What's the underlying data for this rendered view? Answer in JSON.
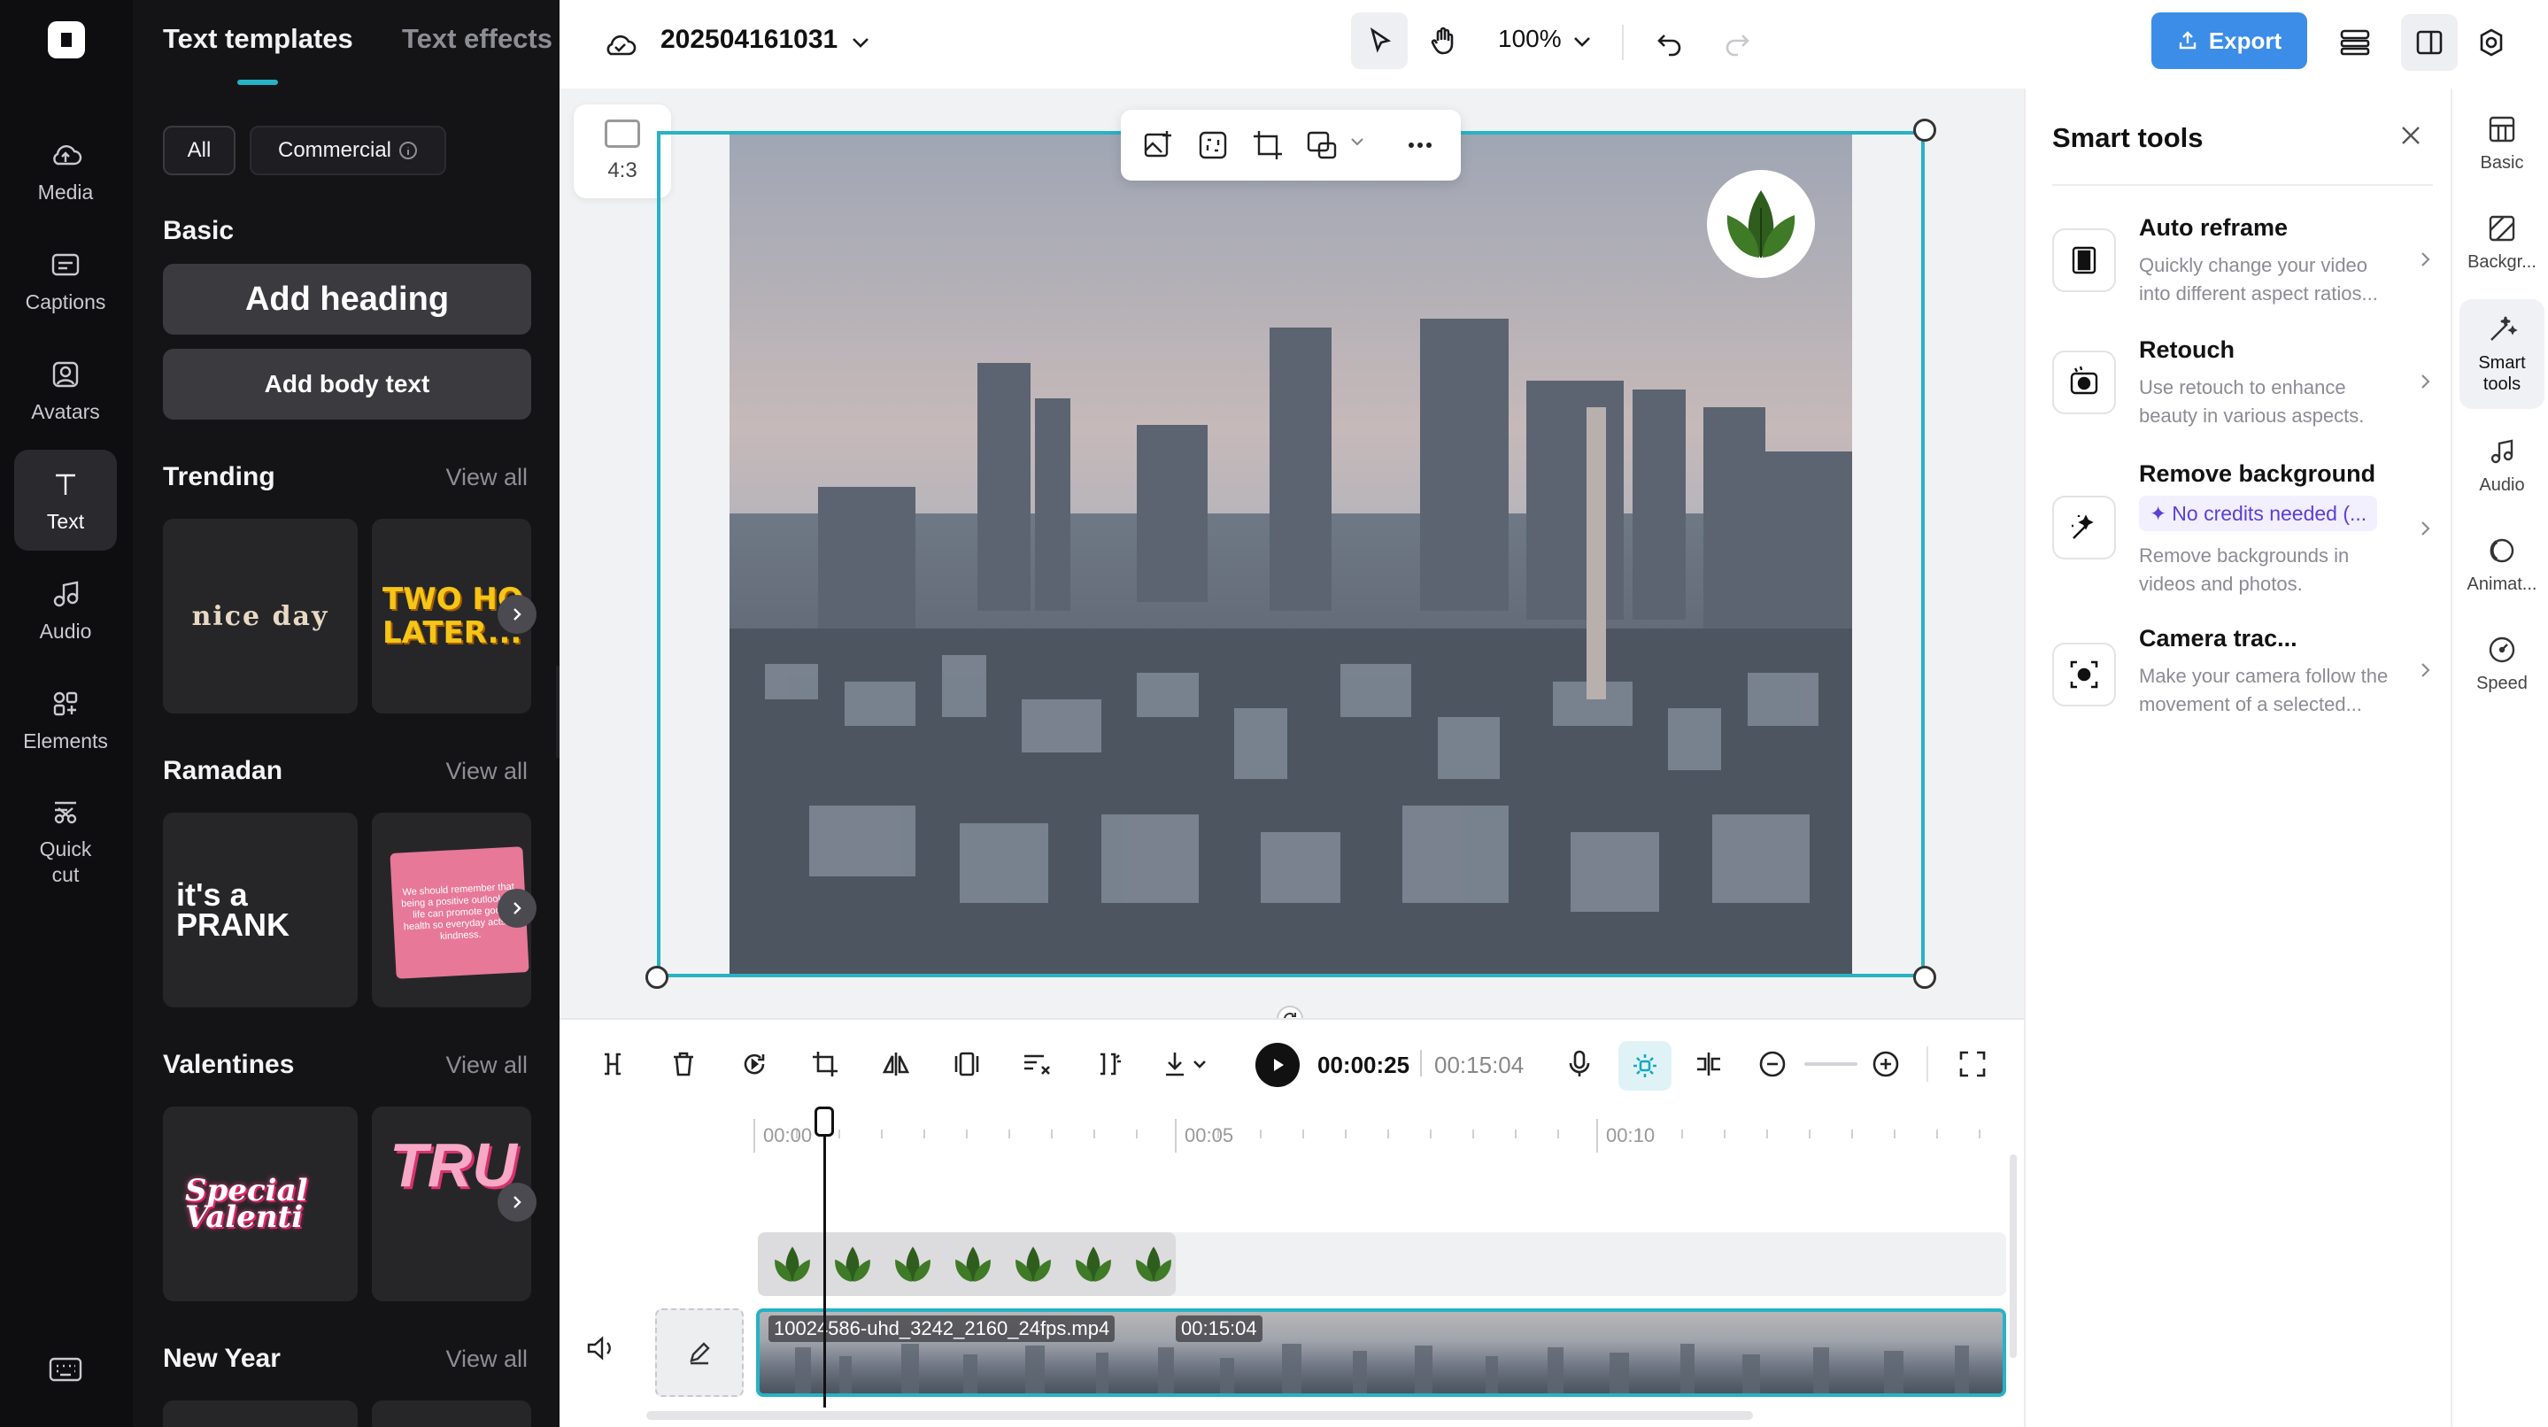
{
  "nav": {
    "items": [
      {
        "label": "Media",
        "icon": "cloud-upload-icon"
      },
      {
        "label": "Captions",
        "icon": "captions-icon"
      },
      {
        "label": "Avatars",
        "icon": "avatar-icon"
      },
      {
        "label": "Text",
        "icon": "text-icon"
      },
      {
        "label": "Audio",
        "icon": "music-note-icon"
      },
      {
        "label": "Elements",
        "icon": "elements-icon"
      },
      {
        "label": "Quick cut",
        "icon": "scissors-icon"
      }
    ],
    "active": "Text"
  },
  "panel": {
    "tabs": [
      "Text templates",
      "Text effects"
    ],
    "filters": {
      "all": "All",
      "commercial": "Commercial"
    },
    "basic": {
      "title": "Basic",
      "add_heading": "Add heading",
      "add_body": "Add body text"
    },
    "sections": [
      {
        "title": "Trending",
        "view_all": "View all",
        "tiles": [
          "nice day",
          "TWO HO LATER..."
        ]
      },
      {
        "title": "Ramadan",
        "view_all": "View all",
        "tiles": [
          "it's a PRANK",
          "We should remember that being a positive outlook on life can promote good health so everyday acts of kindness."
        ]
      },
      {
        "title": "Valentines",
        "view_all": "View all",
        "tiles": [
          "Special Valenti",
          "TRU"
        ]
      },
      {
        "title": "New Year",
        "view_all": "View all",
        "tiles": []
      }
    ]
  },
  "topbar": {
    "project_name": "202504161031",
    "zoom": "100%",
    "export_label": "Export",
    "accent": "#3b8de8"
  },
  "canvas": {
    "aspect_label": "4:3",
    "selection_color": "#27b2c6"
  },
  "timeline": {
    "current_time": "00:00:25",
    "total_time": "00:15:04",
    "ruler": [
      "00:00",
      "00:05",
      "00:10"
    ],
    "clip_name": "10024586-uhd_3242_2160_24fps.mp4",
    "clip_duration": "00:15:04"
  },
  "smart_tools": {
    "title": "Smart tools",
    "items": [
      {
        "title": "Auto reframe",
        "desc": "Quickly change your video into different aspect ratios...",
        "icon": "auto-reframe-icon"
      },
      {
        "title": "Retouch",
        "desc": "Use retouch to enhance beauty in various aspects.",
        "icon": "retouch-icon"
      },
      {
        "title": "Remove background",
        "badge": "No credits needed (...",
        "desc": "Remove backgrounds in videos and photos.",
        "icon": "magic-wand-icon"
      },
      {
        "title": "Camera trac...",
        "desc": "Make your camera follow the movement of a selected...",
        "icon": "camera-track-icon"
      }
    ]
  },
  "right_rail": {
    "items": [
      "Basic",
      "Backgr...",
      "Smart tools",
      "Audio",
      "Animat...",
      "Speed"
    ]
  }
}
